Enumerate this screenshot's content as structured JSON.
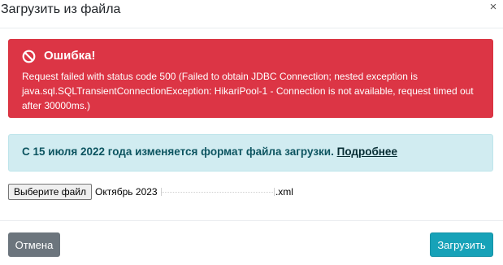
{
  "dialog": {
    "title": "Загрузить из файла",
    "close_glyph": "×"
  },
  "error_alert": {
    "icon": "ban-icon",
    "title": "Ошибка!",
    "message": "Request failed with status code 500 (Failed to obtain JDBC Connection; nested exception is java.sql.SQLTransientConnectionException: HikariPool-1 - Connection is not available, request timed out after 30000ms.)",
    "color": "#dc3545"
  },
  "info_alert": {
    "text": "С 15 июля 2022 года изменяется формат файла загрузки. ",
    "link_text": "Подробнее",
    "color": "#d1ecf1"
  },
  "file_input": {
    "button_label": "Выберите файл",
    "file_name_prefix": "Октябрь 2023",
    "file_name_suffix": ".xml"
  },
  "footer": {
    "cancel_label": "Отмена",
    "upload_label": "Загрузить",
    "cancel_color": "#6c757d",
    "upload_color": "#17a2b8"
  }
}
